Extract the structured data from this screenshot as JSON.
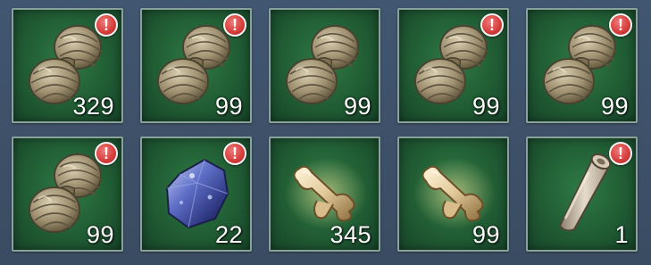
{
  "inventory": {
    "slots": [
      {
        "item_icon": "twine-spool-icon",
        "count": "329",
        "alert": true
      },
      {
        "item_icon": "twine-spool-icon",
        "count": "99",
        "alert": true
      },
      {
        "item_icon": "twine-spool-icon",
        "count": "99",
        "alert": false
      },
      {
        "item_icon": "twine-spool-icon",
        "count": "99",
        "alert": true
      },
      {
        "item_icon": "twine-spool-icon",
        "count": "99",
        "alert": true
      },
      {
        "item_icon": "twine-spool-icon",
        "count": "99",
        "alert": true
      },
      {
        "item_icon": "blue-ore-icon",
        "count": "22",
        "alert": true
      },
      {
        "item_icon": "bone-icon",
        "count": "345",
        "alert": false
      },
      {
        "item_icon": "bone-icon",
        "count": "99",
        "alert": false
      },
      {
        "item_icon": "parchment-scroll-icon",
        "count": "1",
        "alert": true
      }
    ],
    "alert_glyph": "!",
    "colors": {
      "slot_green": "#236236",
      "slot_border": "#8aa39a",
      "alert_red": "#d8403e",
      "background": "#3e5169"
    }
  }
}
